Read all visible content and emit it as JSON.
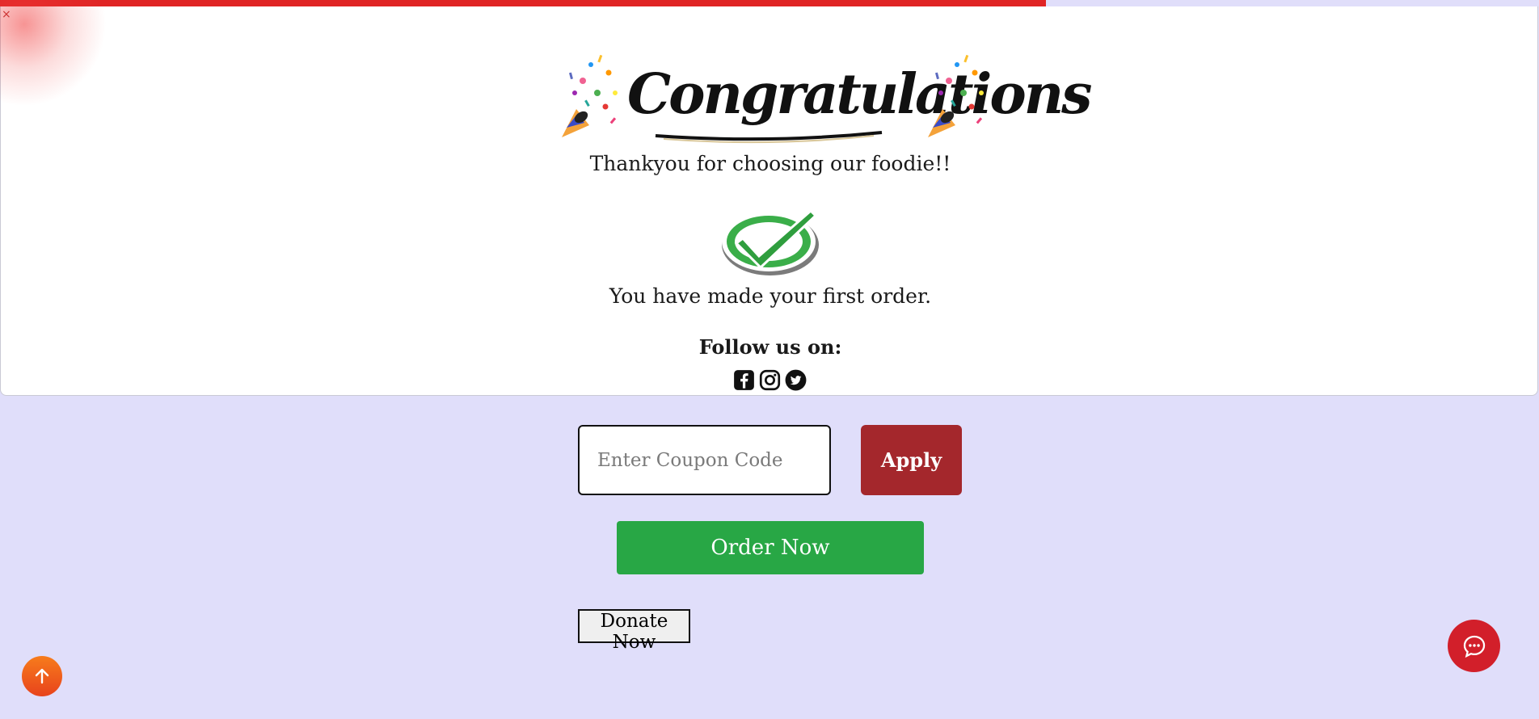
{
  "popup": {
    "close_label": "×",
    "title": "Congratulations",
    "thanks_text": "Thankyou for choosing our foodie!!",
    "order_text": "You have made your first order.",
    "follow_text": "Follow us on:",
    "social_icons": [
      "facebook-icon",
      "instagram-icon",
      "twitter-icon"
    ]
  },
  "coupon": {
    "placeholder": "Enter Coupon Code",
    "value": "",
    "apply_label": "Apply"
  },
  "order_button_label": "Order Now",
  "donate_button_label": "Donate Now",
  "floating": {
    "scroll_top_icon": "arrow-up-icon",
    "chat_icon": "chat-bubble-icon"
  },
  "colors": {
    "page_background": "#e0defa",
    "top_bar": "#e02424",
    "apply_button": "#a4272c",
    "order_button": "#28a745",
    "chat_button": "#d21f2a",
    "scroll_top_button": "#f0621c"
  }
}
